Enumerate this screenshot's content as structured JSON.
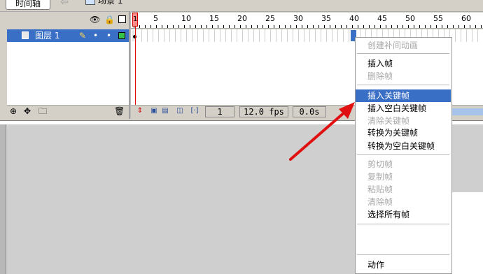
{
  "top_bar": {
    "timeline_tab": "时间轴",
    "back_arrow": "⇦",
    "scene_label": "场景 1"
  },
  "header_icons": {
    "eye": "👁",
    "lock": "🔒"
  },
  "layer": {
    "name": "图层 1",
    "pencil": "✎",
    "dot": "•",
    "swatch_color": "#35c14a"
  },
  "layer_bottom_icons": {
    "add_layer": "⊕",
    "add_guide": "✥",
    "add_folder": "🗀",
    "delete": "🗑"
  },
  "ruler": {
    "playhead_label": "1",
    "labels": [
      "5",
      "10",
      "15",
      "20",
      "25",
      "30",
      "35",
      "40",
      "45",
      "50",
      "55",
      "60"
    ]
  },
  "status": {
    "frame": "1",
    "fps": "12.0 fps",
    "time": "0.0s"
  },
  "timeline_tools": {
    "center": "⇕",
    "onion": "▣",
    "onion_outline": "▤",
    "edit_multiple": "◫",
    "markers": "[·]"
  },
  "context_menu": {
    "items": [
      {
        "label": "创建补间动画",
        "disabled": true
      },
      {
        "label": "插入帧",
        "disabled": false
      },
      {
        "label": "删除帧",
        "disabled": true
      },
      {
        "label": "插入关键帧",
        "disabled": false,
        "active": true
      },
      {
        "label": "插入空白关键帧",
        "disabled": false
      },
      {
        "label": "清除关键帧",
        "disabled": true
      },
      {
        "label": "转换为关键帧",
        "disabled": false
      },
      {
        "label": "转换为空白关键帧",
        "disabled": false
      },
      {
        "label": "剪切帧",
        "disabled": true
      },
      {
        "label": "复制帧",
        "disabled": true
      },
      {
        "label": "粘贴帧",
        "disabled": true
      },
      {
        "label": "清除帧",
        "disabled": true
      },
      {
        "label": "选择所有帧",
        "disabled": false
      },
      {
        "label": "动作",
        "disabled": false
      }
    ]
  },
  "colors": {
    "selection": "#3a6fc6",
    "playhead": "#e01010",
    "arrow": "#e01010",
    "disabled_text": "#a8a8a8"
  }
}
